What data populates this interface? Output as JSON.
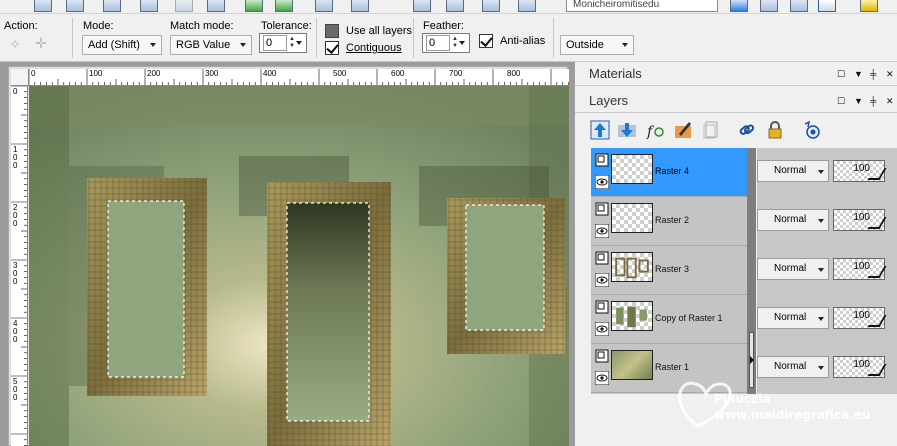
{
  "preset_field": {
    "value": "Monicheiromitisedu"
  },
  "options": {
    "action_label": "Action:",
    "mode_label": "Mode:",
    "mode_value": "Add (Shift)",
    "match_label": "Match mode:",
    "match_value": "RGB Value",
    "tolerance_label": "Tolerance:",
    "tolerance_value": "0",
    "use_all_layers": {
      "label": "Use all layers",
      "checked": false
    },
    "contiguous": {
      "label": "Contiguous",
      "checked": true
    },
    "feather_label": "Feather:",
    "feather_value": "0",
    "antialias": {
      "label": "Anti-alias",
      "checked": true
    },
    "aa_mode_value": "Outside"
  },
  "ruler": {
    "h_ticks": [
      "0",
      "100",
      "200",
      "300",
      "400",
      "500",
      "600",
      "700",
      "800"
    ],
    "v_ticks": [
      "0",
      "1\n0\n0",
      "2\n0\n0",
      "3\n0\n0",
      "4\n0\n0",
      "5\n0\n0"
    ]
  },
  "materials_panel": {
    "title": "Materials"
  },
  "layers_panel": {
    "title": "Layers",
    "layers": [
      {
        "name": "Raster 4",
        "blend": "Normal",
        "opacity": "100",
        "selected": true
      },
      {
        "name": "Raster 2",
        "blend": "Normal",
        "opacity": "100",
        "selected": false
      },
      {
        "name": "Raster 3",
        "blend": "Normal",
        "opacity": "100",
        "selected": false
      },
      {
        "name": "Copy of Raster 1",
        "blend": "Normal",
        "opacity": "100",
        "selected": false
      },
      {
        "name": "Raster 1",
        "blend": "Normal",
        "opacity": "100",
        "selected": false
      }
    ]
  },
  "watermark": {
    "line1": "Pinuccia",
    "line2": "www.maidiregrafica.eu"
  },
  "colors": {
    "selection_blue": "#3399ff",
    "panel_gray": "#c7c7c7"
  }
}
